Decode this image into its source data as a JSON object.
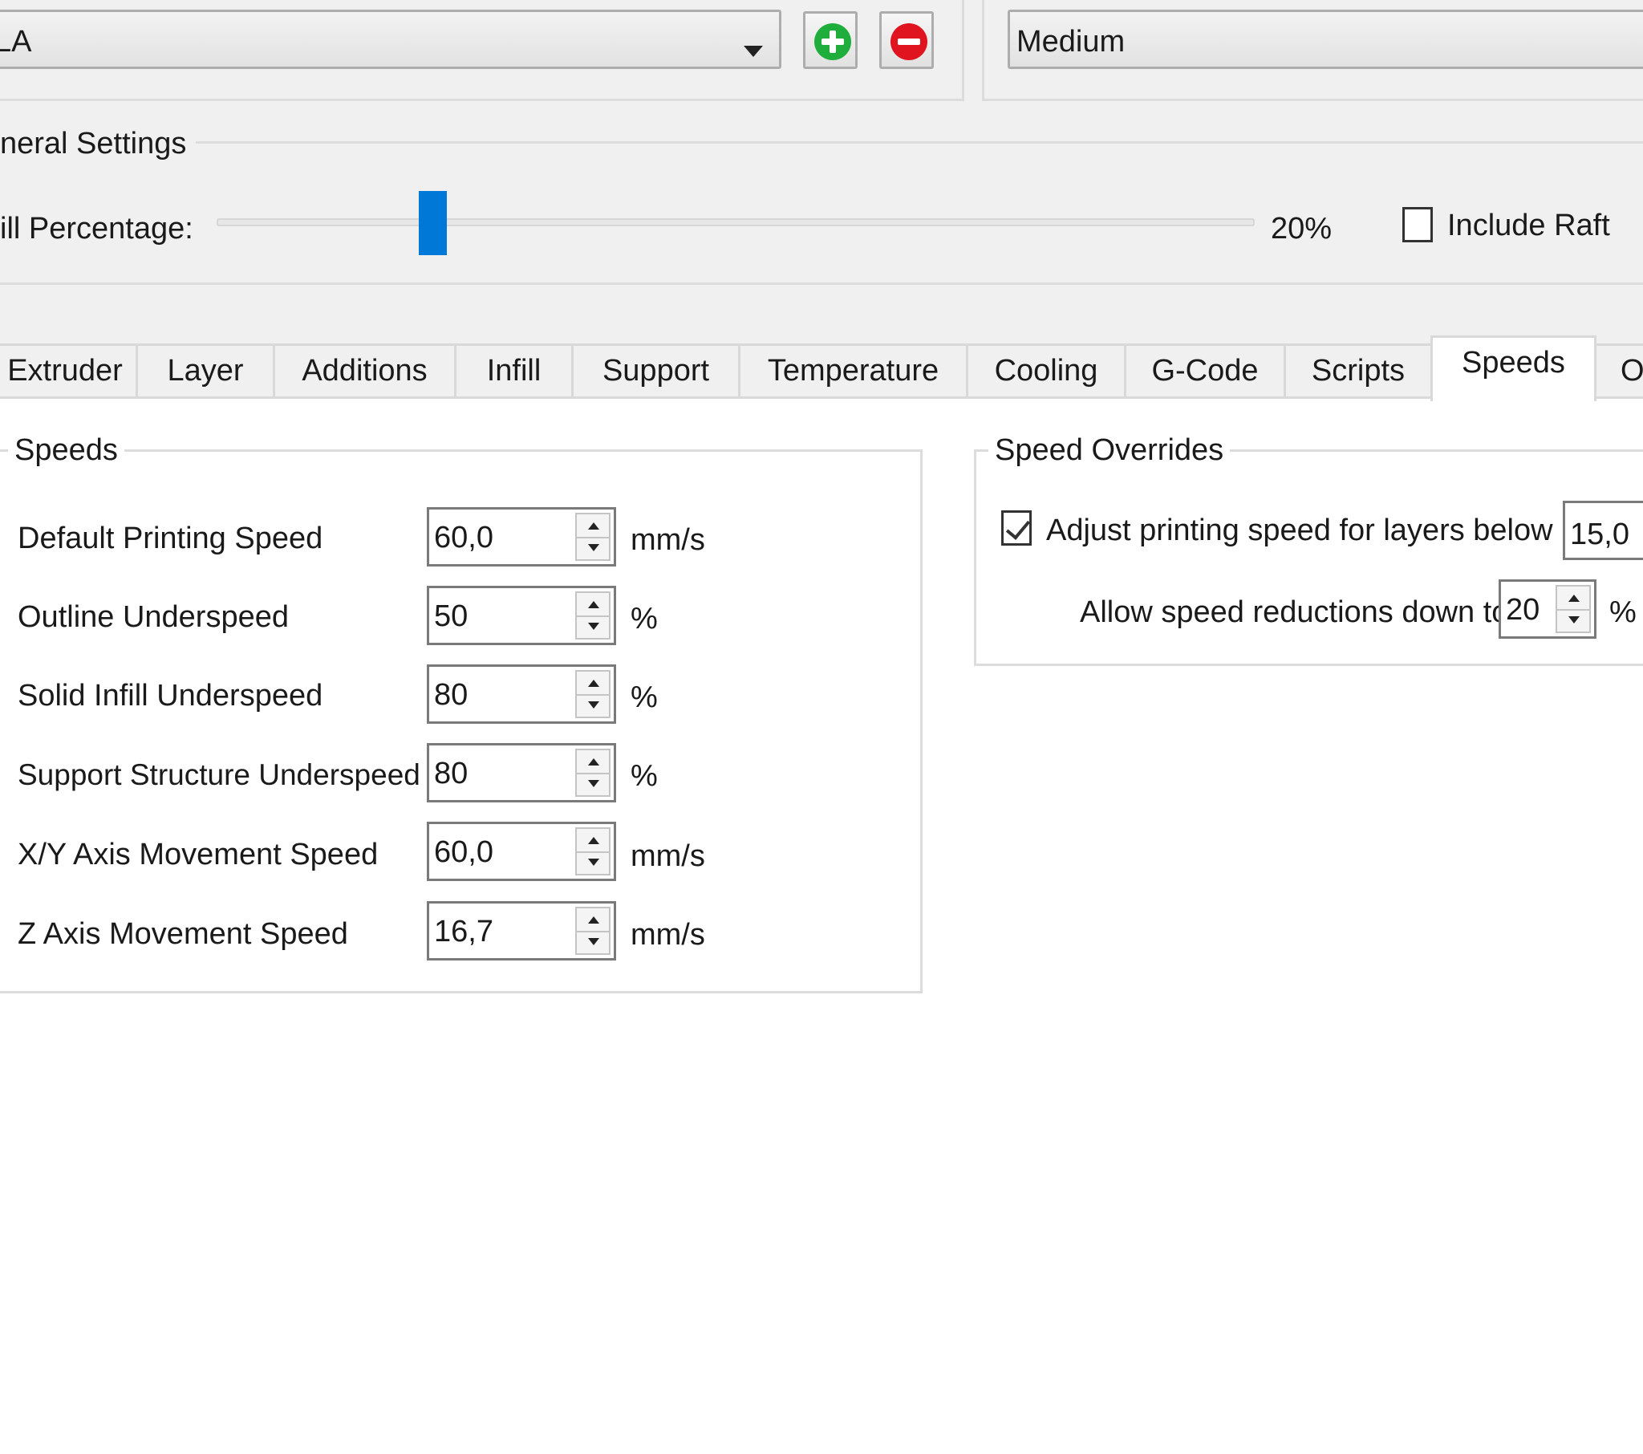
{
  "toolbar": {
    "material_value": "LA",
    "quality_value": "Medium"
  },
  "general": {
    "title": "neral Settings",
    "infill_label": "ill Percentage:",
    "infill_value_text": "20%",
    "infill_fraction": 0.2,
    "include_raft_label": "Include Raft",
    "include_raft_checked": false
  },
  "tabs": [
    {
      "label": "Extruder"
    },
    {
      "label": "Layer"
    },
    {
      "label": "Additions"
    },
    {
      "label": "Infill"
    },
    {
      "label": "Support"
    },
    {
      "label": "Temperature"
    },
    {
      "label": "Cooling"
    },
    {
      "label": "G-Code"
    },
    {
      "label": "Scripts"
    },
    {
      "label": "Speeds",
      "active": true
    },
    {
      "label": "O"
    }
  ],
  "speeds": {
    "title": "Speeds",
    "rows": [
      {
        "label": "Default Printing Speed",
        "value": "60,0",
        "unit": "mm/s"
      },
      {
        "label": "Outline Underspeed",
        "value": "50",
        "unit": "%"
      },
      {
        "label": "Solid Infill Underspeed",
        "value": "80",
        "unit": "%"
      },
      {
        "label": "Support Structure Underspeed",
        "value": "80",
        "unit": "%"
      },
      {
        "label": "X/Y Axis Movement Speed",
        "value": "60,0",
        "unit": "mm/s"
      },
      {
        "label": "Z Axis Movement Speed",
        "value": "16,7",
        "unit": "mm/s"
      }
    ]
  },
  "overrides": {
    "title": "Speed Overrides",
    "adjust_label": "Adjust printing speed for layers below",
    "adjust_checked": true,
    "adjust_value": "15,0",
    "allow_label": "Allow speed reductions down to",
    "allow_value": "20",
    "allow_unit": "%"
  },
  "colors": {
    "add_green": "#1fae3c",
    "remove_red": "#e0141f",
    "slider_blue": "#0078d7"
  },
  "icons": [
    "dropdown-arrow-icon",
    "add-circle-icon",
    "remove-circle-icon",
    "spin-up-icon",
    "spin-down-icon",
    "checkmark-icon"
  ]
}
